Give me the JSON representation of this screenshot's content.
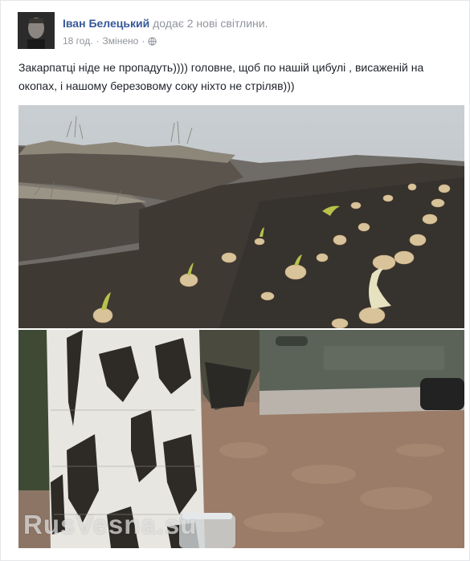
{
  "post": {
    "author": "Іван Белецький",
    "action": "додає 2 нові світлини.",
    "time": "18 год.",
    "separator": "·",
    "edited": "Змінено",
    "text": "Закарпатці ніде не пропадуть)))) головне, щоб по нашій цибулі , висаженій на окопах, і нашому березовому соку ніхто не стріляв)))"
  },
  "photos": {
    "watermark": "RusVesna.su"
  },
  "icons": {
    "privacy": "globe-icon"
  }
}
